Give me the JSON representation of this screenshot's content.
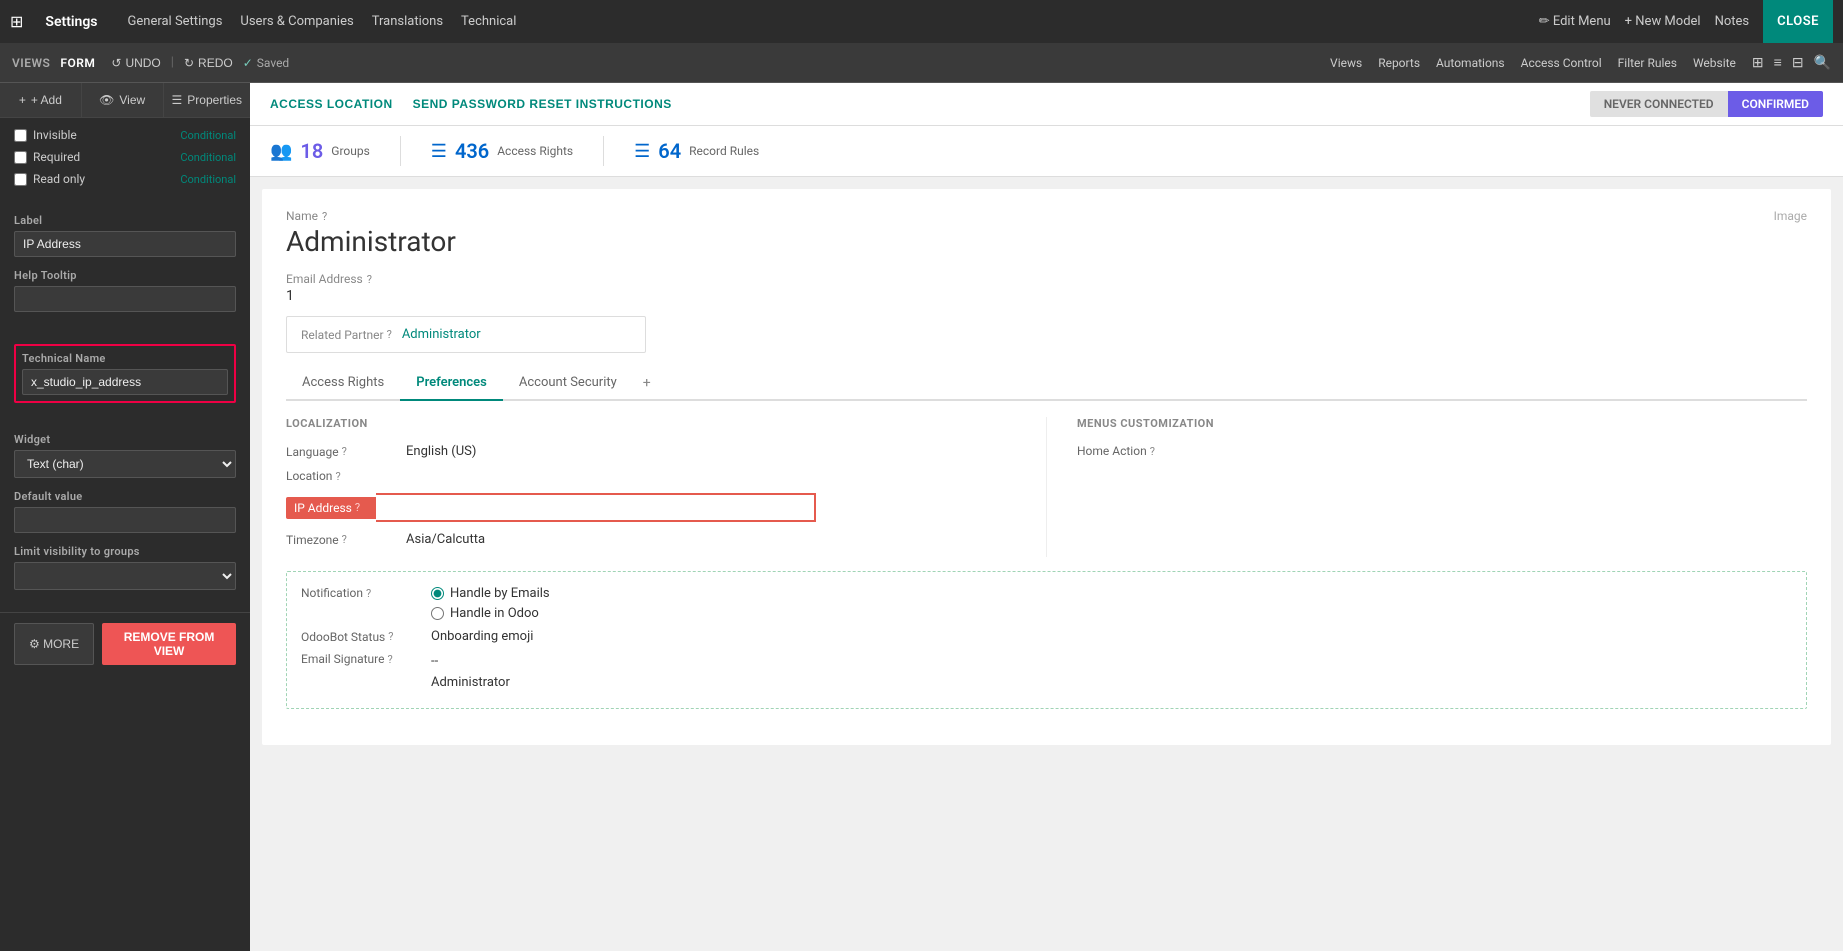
{
  "topnav": {
    "app_icon": "⊞",
    "app_name": "Settings",
    "menu_items": [
      "General Settings",
      "Users & Companies",
      "Translations",
      "Technical"
    ],
    "edit_menu_label": "✏ Edit Menu",
    "new_model_label": "+ New Model",
    "notes_label": "Notes",
    "close_label": "CLOSE"
  },
  "second_toolbar": {
    "views_label": "VIEWS",
    "form_label": "FORM",
    "undo_label": "UNDO",
    "redo_label": "REDO",
    "saved_label": "Saved",
    "toolbar_right": [
      "Views",
      "Reports",
      "Automations",
      "Access Control",
      "Filter Rules",
      "Website"
    ]
  },
  "sidebar": {
    "add_label": "+ Add",
    "view_label": "View",
    "properties_label": "Properties",
    "invisible_label": "Invisible",
    "invisible_cond": "Conditional",
    "required_label": "Required",
    "required_cond": "Conditional",
    "readonly_label": "Read only",
    "readonly_cond": "Conditional",
    "label_section": "Label",
    "label_value": "IP Address",
    "help_tooltip_label": "Help Tooltip",
    "help_tooltip_value": "",
    "technical_name_label": "Technical Name",
    "technical_name_value": "x_studio_ip_address",
    "widget_label": "Widget",
    "widget_value": "Text (char)",
    "default_value_label": "Default value",
    "default_value": "",
    "limit_visibility_label": "Limit visibility to groups",
    "limit_visibility_value": "",
    "more_label": "⚙ MORE",
    "remove_label": "REMOVE FROM VIEW"
  },
  "header": {
    "access_location_label": "ACCESS LOCATION",
    "send_password_label": "SEND PASSWORD RESET INSTRUCTIONS",
    "never_connected_label": "NEVER CONNECTED",
    "confirmed_label": "CONFIRMED"
  },
  "stats": {
    "groups_count": "18",
    "groups_label": "Groups",
    "access_rights_count": "436",
    "access_rights_label": "Access Rights",
    "record_rules_count": "64",
    "record_rules_label": "Record Rules"
  },
  "form": {
    "name_label": "Name",
    "name_help": "?",
    "name_value": "Administrator",
    "image_placeholder": "Image",
    "email_label": "Email Address",
    "email_help": "?",
    "email_value": "1",
    "related_partner_label": "Related Partner",
    "related_partner_help": "?",
    "related_partner_value": "Administrator"
  },
  "tabs": [
    {
      "label": "Access Rights",
      "active": false
    },
    {
      "label": "Preferences",
      "active": true
    },
    {
      "label": "Account Security",
      "active": false
    }
  ],
  "tab_add_icon": "+",
  "preferences": {
    "localization_title": "LOCALIZATION",
    "language_label": "Language",
    "language_help": "?",
    "language_value": "English (US)",
    "location_label": "Location",
    "location_help": "?",
    "ip_address_label": "IP Address",
    "ip_address_help": "?",
    "ip_address_value": "",
    "timezone_label": "Timezone",
    "timezone_help": "?",
    "timezone_value": "Asia/Calcutta",
    "menus_title": "MENUS CUSTOMIZATION",
    "home_action_label": "Home Action",
    "home_action_help": "?",
    "notification_label": "Notification",
    "notification_help": "?",
    "notification_option1": "Handle by Emails",
    "notification_option2": "Handle in Odoo",
    "odobot_label": "OdooBot Status",
    "odobot_help": "?",
    "odobot_value": "Onboarding emoji",
    "email_sig_label": "Email Signature",
    "email_sig_help": "?",
    "email_sig_line1": "--",
    "email_sig_line2": "Administrator"
  }
}
